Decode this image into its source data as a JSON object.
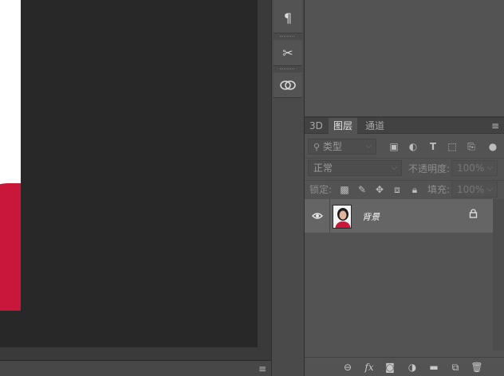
{
  "tool_strip": {
    "tools": [
      {
        "name": "paragraph",
        "icon": "pilcrow-icon",
        "glyph": "¶"
      },
      {
        "name": "tools",
        "icon": "scissors-icon",
        "glyph": "✂"
      },
      {
        "name": "creative-cloud",
        "icon": "creative-cloud-icon",
        "glyph": "⊗"
      }
    ]
  },
  "layers_panel": {
    "tabs": [
      {
        "label": "3D",
        "active": false
      },
      {
        "label": "图层",
        "active": true
      },
      {
        "label": "通道",
        "active": false
      }
    ],
    "filter": {
      "label": "类型"
    },
    "blend_mode": {
      "value": "正常"
    },
    "opacity": {
      "label": "不透明度:",
      "value": "100%"
    },
    "lock": {
      "label": "锁定:"
    },
    "fill": {
      "label": "填充:",
      "value": "100%"
    },
    "layers": [
      {
        "name": "背景",
        "visible": true,
        "locked": true
      }
    ]
  },
  "colors": {
    "accent_red": "#c8173a",
    "panel_bg": "#535353",
    "canvas_bg": "#282828"
  }
}
